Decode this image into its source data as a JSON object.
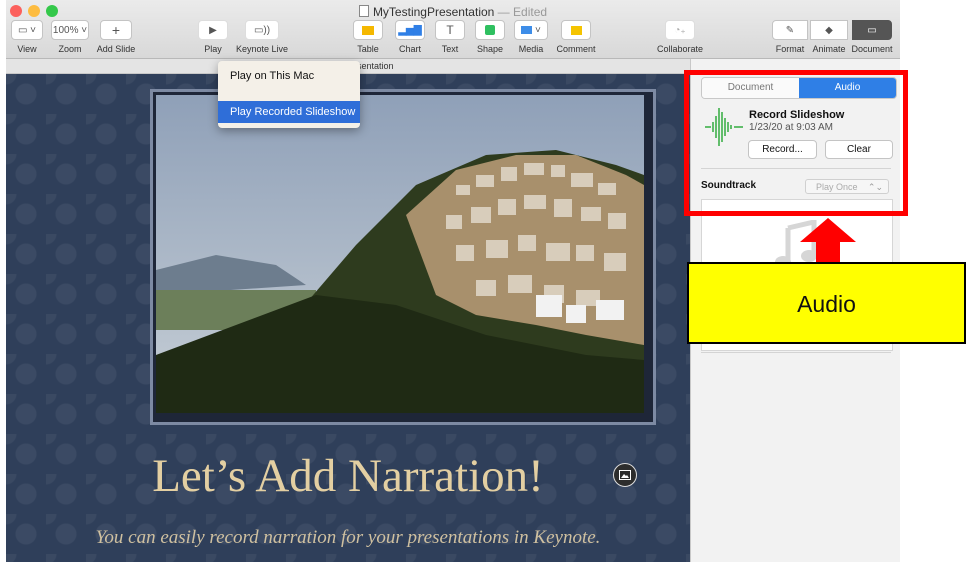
{
  "window": {
    "title": "MyTestingPresentation",
    "title_suffix": " — Edited",
    "document_name": "MyTestingPresentation"
  },
  "toolbar": {
    "view": "View",
    "zoom_value": "100%",
    "zoom": "Zoom",
    "add_slide": "Add Slide",
    "play": "Play",
    "keynote_live": "Keynote Live",
    "table": "Table",
    "chart": "Chart",
    "text": "Text",
    "shape": "Shape",
    "media": "Media",
    "comment": "Comment",
    "collaborate": "Collaborate",
    "format": "Format",
    "animate": "Animate",
    "document": "Document"
  },
  "play_menu": {
    "items": [
      "Play on This Mac",
      "Play Recorded Slideshow"
    ],
    "selected": "Play Recorded Slideshow"
  },
  "slide": {
    "title": "Let’s Add Narration!",
    "subtitle": "You can easily record narration for your presentations in Keynote."
  },
  "inspector": {
    "tabs": [
      "Document",
      "Audio"
    ],
    "active_tab": "Audio",
    "record_title": "Record Slideshow",
    "record_date": "1/23/20 at 9:03 AM",
    "record_button": "Record...",
    "clear_button": "Clear",
    "soundtrack_label": "Soundtrack",
    "soundtrack_mode": "Play Once"
  },
  "annotation": {
    "callout_text": "Audio",
    "highlight_color": "#ff0000",
    "callout_color": "#ffff00"
  },
  "colors": {
    "accent": "#2f7fe6",
    "slide_background": "#2f3f5a",
    "slide_title": "#e3cfa2"
  }
}
